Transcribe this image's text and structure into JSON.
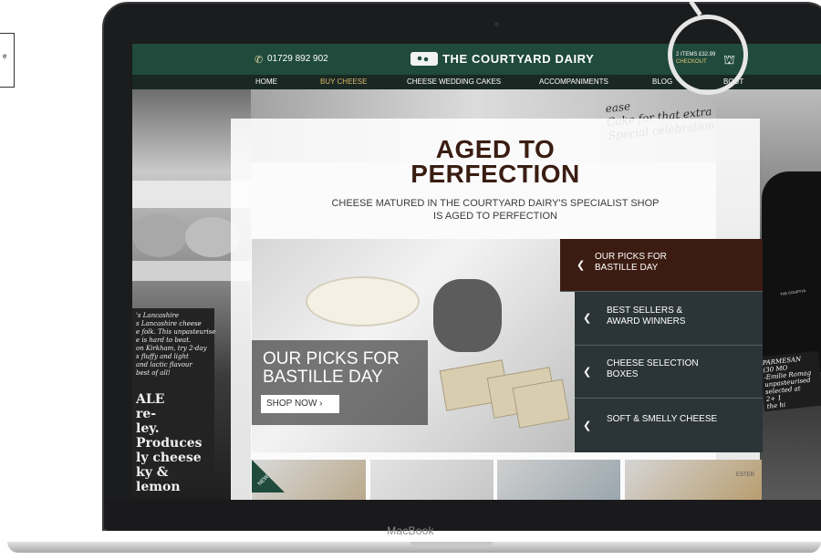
{
  "side_note": {
    "text": "e"
  },
  "device": {
    "brand_label": "MacBook"
  },
  "header": {
    "phone": "01729 892 902",
    "logo_text": "THE COURTYARD DAIRY",
    "cart_summary": "2 ITEMS £32.99",
    "cart_checkout": "CHECKOUT"
  },
  "nav": {
    "items": [
      {
        "label": "HOME"
      },
      {
        "label": "BUY CHEESE"
      },
      {
        "label": "CHEESE WEDDING CAKES"
      },
      {
        "label": "ACCOMPANIMENTS"
      },
      {
        "label": "BLOG"
      },
      {
        "label": "BOUT"
      }
    ],
    "active_color": "#d9b86a"
  },
  "hero": {
    "title_line1": "AGED TO",
    "title_line2": "PERFECTION",
    "subtitle_line1": "CHEESE MATURED IN THE COURTYARD DAIRY'S SPECIALIST SHOP",
    "subtitle_line2": "IS AGED TO PERFECTION"
  },
  "feature": {
    "title_line1": "OUR PICKS FOR",
    "title_line2": "BASTILLE DAY",
    "cta": "SHOP NOW ›"
  },
  "menu": {
    "items": [
      {
        "line1": "OUR PICKS FOR",
        "line2": "BASTILLE DAY",
        "active": true
      },
      {
        "line1": "BEST SELLERS &",
        "line2": "AWARD WINNERS",
        "active": false
      },
      {
        "line1": "CHEESE SELECTION",
        "line2": "BOXES",
        "active": false
      },
      {
        "line1": "SOFT & SMELLY CHEESE",
        "line2": "",
        "active": false
      }
    ]
  },
  "thumbnails": {
    "badge": "NEW",
    "tester_label": "ESTER"
  },
  "backdrop": {
    "chalk_small": "'s Lancashire\ns Lancashire cheese\ne folk. This unpasteurise\ne is hard to beat.\non Kirkham, try 2-day\ns fluffy and light\nand lactic flavour\nbest of all!",
    "chalk_big": "ALE\nre-\nley.\nProduces\nly cheese\nky &\nlemon",
    "handwriting": "ease\nCake for that extra\nSpecial celebration",
    "parmesan": "PARMESAN\n(30 MO\n-Emilie Romag\nunpasteurised\nselected at\n2+ 1\nthe hi",
    "apron_text": "THE COURTYA"
  },
  "colors": {
    "header_green": "#1f4a3c",
    "menu_active_brown": "#3c1c12",
    "menu_dark": "#2b3436",
    "title_brown": "#3a1d12"
  }
}
